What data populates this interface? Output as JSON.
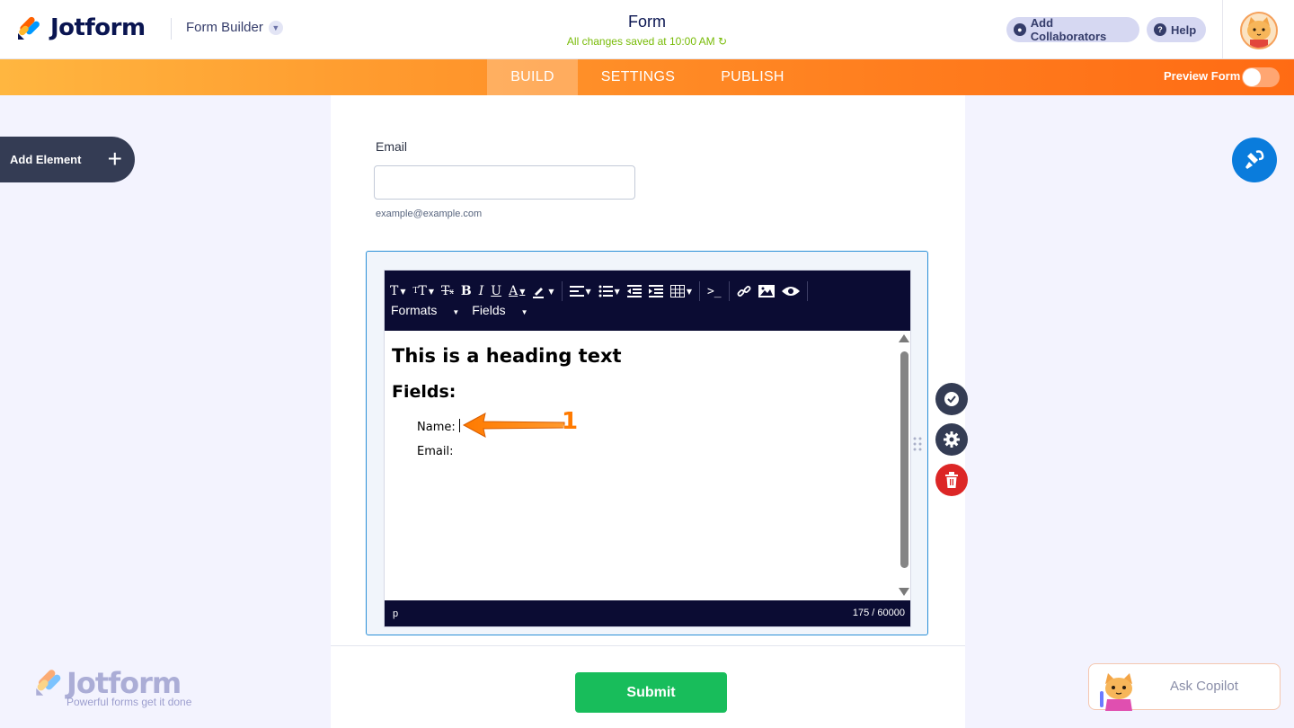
{
  "header": {
    "brand": "Jotform",
    "builder_menu": "Form Builder",
    "form_title": "Form",
    "saved_status": "All changes saved at 10:00 AM",
    "collaborators_label": "Add Collaborators",
    "help_label": "Help"
  },
  "nav": {
    "tabs": [
      {
        "label": "BUILD",
        "active": true
      },
      {
        "label": "SETTINGS",
        "active": false
      },
      {
        "label": "PUBLISH",
        "active": false
      }
    ],
    "preview_label": "Preview Form",
    "preview_on": false
  },
  "sidebar": {
    "add_element_label": "Add Element"
  },
  "form": {
    "email_label": "Email",
    "email_value": "",
    "email_sublabel": "example@example.com",
    "editor": {
      "toolbar_menus": [
        "Formats",
        "Fields"
      ],
      "heading": "This is a heading text",
      "subheading": "Fields:",
      "lines": [
        "Name:",
        "Email:"
      ],
      "status_path": "p",
      "char_count": "175 / 60000"
    },
    "submit_label": "Submit"
  },
  "watermark": {
    "brand": "Jotform",
    "tagline": "Powerful forms get it done"
  },
  "copilot": {
    "label": "Ask Copilot"
  },
  "annotation": {
    "number": "1"
  },
  "colors": {
    "brand_navy": "#0a1551",
    "accent_orange": "#ff6100",
    "submit_green": "#18bd5b",
    "delete_red": "#dc2626",
    "selection_blue": "#2a8fd7"
  }
}
